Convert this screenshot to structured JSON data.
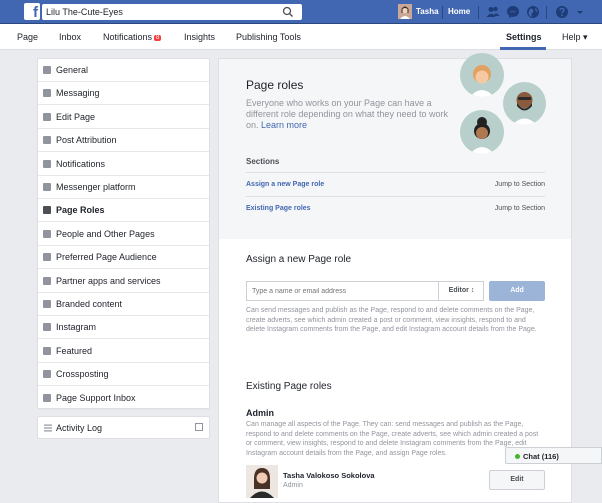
{
  "topbar": {
    "search_value": "Lilu The-Cute-Eyes",
    "user_name": "Tasha",
    "home": "Home"
  },
  "pagenav": {
    "page": "Page",
    "inbox": "Inbox",
    "notifications": "Notifications",
    "notifications_badge": "8",
    "insights": "Insights",
    "publishing_tools": "Publishing Tools",
    "settings": "Settings",
    "help": "Help ▾"
  },
  "leftnav": {
    "items": [
      {
        "label": "General",
        "icon": "gear-icon"
      },
      {
        "label": "Messaging",
        "icon": "message-icon"
      },
      {
        "label": "Edit Page",
        "icon": "pencil-icon"
      },
      {
        "label": "Post Attribution",
        "icon": "flag-icon"
      },
      {
        "label": "Notifications",
        "icon": "globe-icon"
      },
      {
        "label": "Messenger platform",
        "icon": "messenger-icon"
      },
      {
        "label": "Page Roles",
        "icon": "person-icon"
      },
      {
        "label": "People and Other Pages",
        "icon": "people-icon"
      },
      {
        "label": "Preferred Page Audience",
        "icon": "audience-icon"
      },
      {
        "label": "Partner apps and services",
        "icon": "apps-icon"
      },
      {
        "label": "Branded content",
        "icon": "handshake-icon"
      },
      {
        "label": "Instagram",
        "icon": "instagram-icon"
      },
      {
        "label": "Featured",
        "icon": "star-icon"
      },
      {
        "label": "Crossposting",
        "icon": "video-icon"
      },
      {
        "label": "Page Support Inbox",
        "icon": "inbox-icon"
      }
    ],
    "active_index": 6,
    "activity_log": "Activity Log"
  },
  "main": {
    "title": "Page roles",
    "description": "Everyone who works on your Page can have a different role depending on what they need to work on.",
    "learn_more": "Learn more",
    "sections_heading": "Sections",
    "sections": [
      {
        "label": "Assign a new Page role",
        "jump": "Jump to Section"
      },
      {
        "label": "Existing Page roles",
        "jump": "Jump to Section"
      }
    ],
    "assign_heading": "Assign a new Page role",
    "assign_placeholder": "Type a name or email address",
    "role_select": "Editor ↕",
    "add_button": "Add",
    "editor_help": "Can send messages and publish as the Page, respond to and delete comments on the Page, create adverts, see which admin created a post or comment, view insights, respond to and delete Instagram comments from the Page, and edit Instagram account details from the Page.",
    "existing_heading": "Existing Page roles",
    "admin_heading": "Admin",
    "admin_help": "Can manage all aspects of the Page. They can: send messages and publish as the Page, respond to and delete comments on the Page, create adverts, see which admin created a post or comment, view insights, respond to and delete Instagram comments from the Page, edit Instagram account details from the Page, and assign Page roles.",
    "person_name": "Tasha Valokoso Sokolova",
    "person_role": "Admin",
    "edit_button": "Edit"
  },
  "chat": {
    "label": "Chat (116)"
  },
  "colors": {
    "brand": "#4267b2",
    "badge": "#fa3e3e",
    "online": "#42b72a"
  }
}
